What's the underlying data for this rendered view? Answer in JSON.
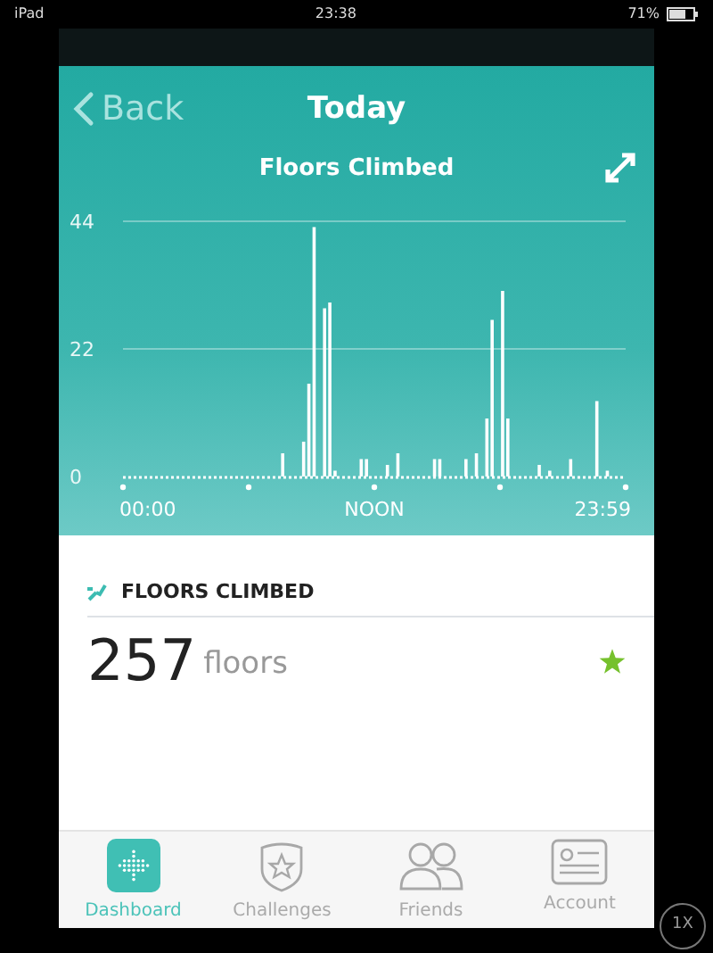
{
  "status_bar": {
    "device": "iPad",
    "time": "23:38",
    "battery": "71%"
  },
  "header": {
    "back": "Back",
    "title": "Today"
  },
  "chart_panel": {
    "time_labels": [
      "00:00",
      "NOON",
      "23:59"
    ],
    "chart_data": {
      "type": "bar",
      "title": "Floors Climbed",
      "ylim": [
        0,
        44
      ],
      "yticks": [
        0,
        22,
        44
      ],
      "values": [
        0,
        0,
        0,
        0,
        0,
        0,
        0,
        0,
        0,
        0,
        0,
        0,
        0,
        0,
        0,
        0,
        0,
        0,
        0,
        0,
        0,
        0,
        0,
        0,
        0,
        0,
        0,
        0,
        0,
        0,
        4,
        0,
        0,
        0,
        6,
        16,
        43,
        0,
        29,
        30,
        1,
        0,
        0,
        0,
        0,
        3,
        3,
        0,
        0,
        0,
        2,
        0,
        4,
        0,
        0,
        0,
        0,
        0,
        0,
        3,
        3,
        0,
        0,
        0,
        0,
        3,
        0,
        4,
        0,
        10,
        27,
        0,
        32,
        10,
        0,
        0,
        0,
        0,
        0,
        2,
        0,
        1,
        0,
        0,
        0,
        3,
        0,
        0,
        0,
        0,
        13,
        0,
        1,
        0,
        0,
        0
      ]
    }
  },
  "summary": {
    "heading": "FLOORS CLIMBED",
    "value": "257",
    "unit": "floors",
    "goal_met": true
  },
  "tabs": [
    {
      "label": "Dashboard",
      "kind": "dashboard",
      "selected": true
    },
    {
      "label": "Challenges",
      "kind": "challenges",
      "selected": false
    },
    {
      "label": "Friends",
      "kind": "friends",
      "selected": false
    },
    {
      "label": "Account",
      "kind": "account",
      "selected": false
    }
  ],
  "speed_button": "1X"
}
